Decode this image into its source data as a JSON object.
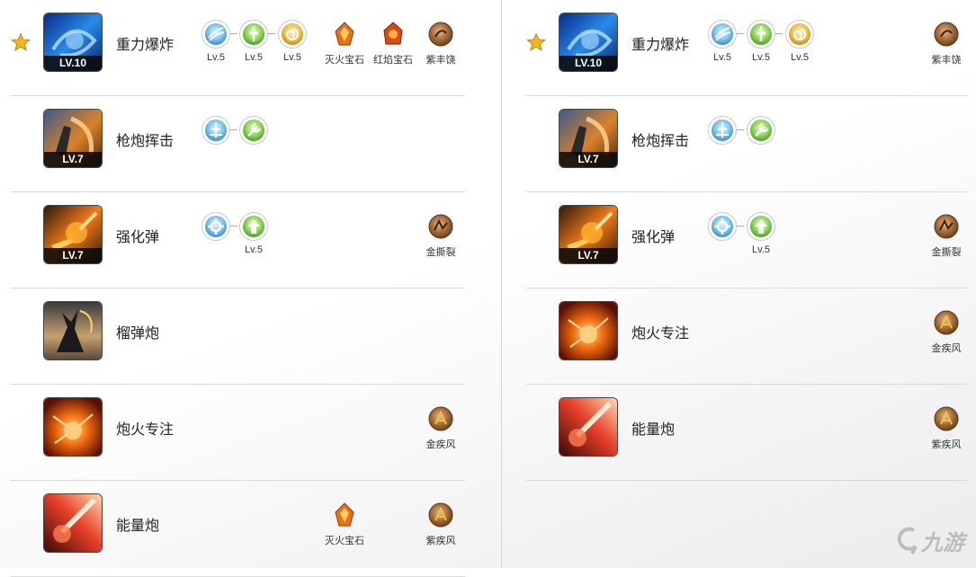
{
  "icons": {
    "star": "star-icon",
    "rune_blue_wind": "wind-rune-icon",
    "rune_green_sword": "sword-rune-icon",
    "rune_gold_swirl": "swirl-rune-icon",
    "rune_blue_sword": "blue-sword-rune-icon",
    "rune_green_wrench": "wrench-rune-icon",
    "rune_blue_gear": "gear-rune-icon",
    "rune_green_up": "up-arrow-rune-icon",
    "gem_fire": "fire-gem-icon",
    "gem_red": "red-flame-gem-icon",
    "charm": "charm-icon"
  },
  "colors": {
    "divider": "#d9d9d9",
    "rune_blue": "#4aa3e0",
    "rune_green": "#5fb83a",
    "rune_gold": "#d9a22a",
    "charm_brown": "#8a5a2e"
  },
  "left": {
    "rows": [
      {
        "name": "重力爆炸",
        "level": "LV.10",
        "runes": [
          {
            "caption": "Lv.5"
          },
          {
            "caption": "Lv.5"
          },
          {
            "caption": "Lv.5"
          }
        ],
        "gems": [
          {
            "caption": "灭火宝石"
          },
          {
            "caption": "红焰宝石"
          }
        ],
        "charm": "紫丰饶"
      },
      {
        "name": "枪炮挥击",
        "level": "LV.7"
      },
      {
        "name": "强化弹",
        "level": "LV.7",
        "rune_caption": "Lv.5",
        "charm": "金撕裂"
      },
      {
        "name": "榴弹炮"
      },
      {
        "name": "炮火专注",
        "charm": "金疾风"
      },
      {
        "name": "能量炮",
        "gem": "灭火宝石",
        "charm": "紫疾风"
      }
    ]
  },
  "right": {
    "rows": [
      {
        "name": "重力爆炸",
        "level": "LV.10",
        "runes": [
          {
            "caption": "Lv.5"
          },
          {
            "caption": "Lv.5"
          },
          {
            "caption": "Lv.5"
          }
        ],
        "charm": "紫丰饶"
      },
      {
        "name": "枪炮挥击",
        "level": "LV.7"
      },
      {
        "name": "强化弹",
        "level": "LV.7",
        "rune_caption": "Lv.5",
        "charm": "金撕裂"
      },
      {
        "name": "炮火专注",
        "charm": "金疾风"
      },
      {
        "name": "能量炮",
        "charm": "紫疾风"
      }
    ]
  },
  "watermark": "九游"
}
